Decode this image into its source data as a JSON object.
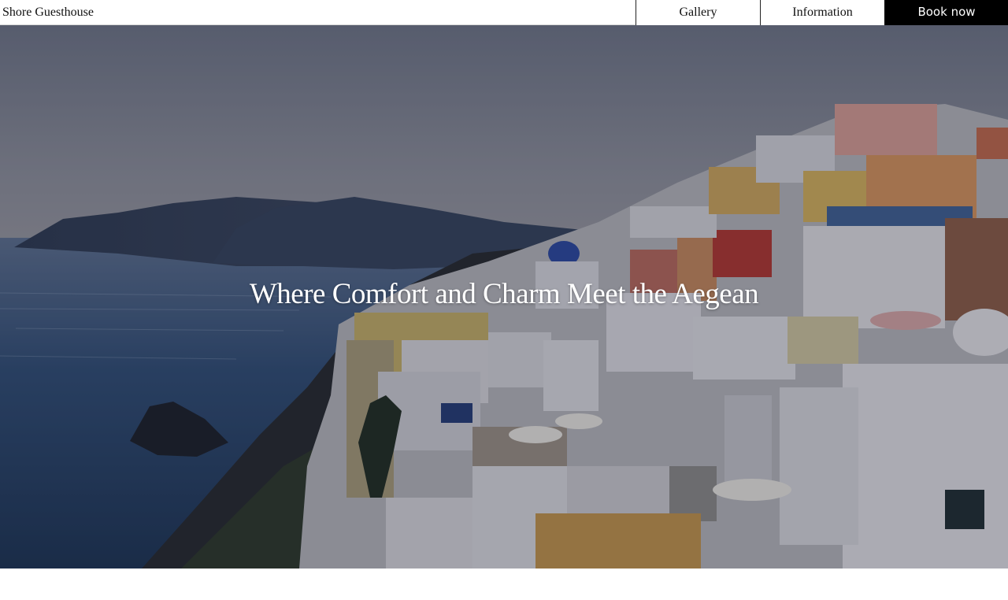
{
  "header": {
    "brand": "Shore Guesthouse",
    "nav": {
      "gallery": "Gallery",
      "information": "Information",
      "book": "Book now"
    }
  },
  "hero": {
    "title": "Where Comfort and Charm Meet the Aegean",
    "image": "santorini-cliffside-village-photo"
  },
  "colors": {
    "book_button_bg": "#000000",
    "book_button_text": "#ffffff",
    "overlay": "#1a1f2e"
  }
}
